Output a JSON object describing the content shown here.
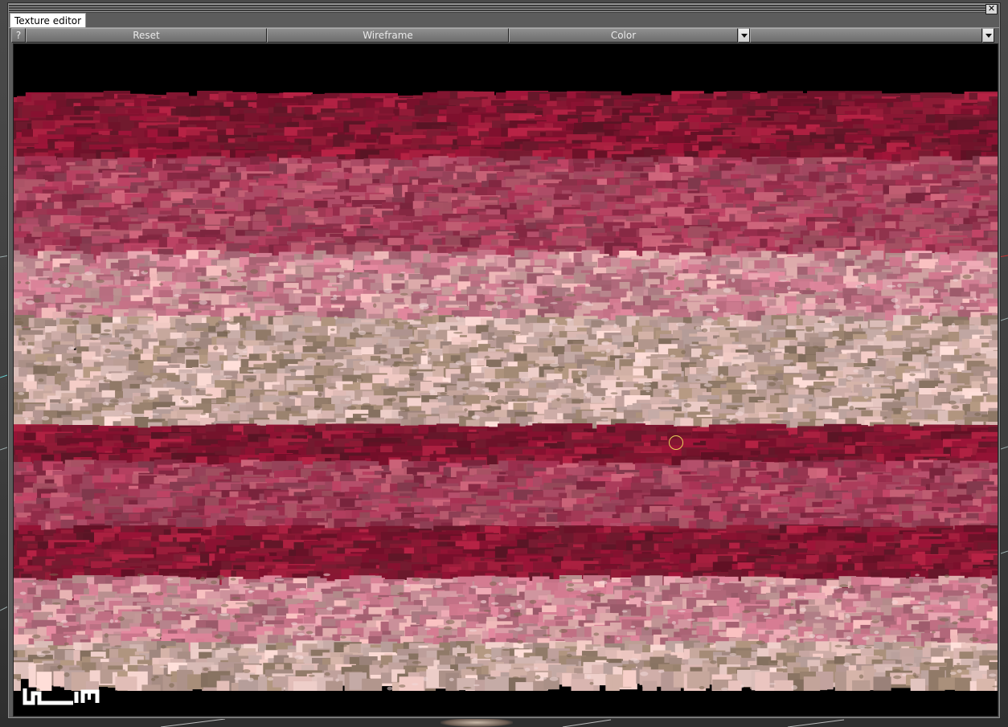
{
  "window": {
    "tab_label": "Texture editor",
    "close_glyph": "✕"
  },
  "toolbar": {
    "help_label": "?",
    "reset_label": "Reset",
    "wireframe_label": "Wireframe",
    "mode_select_value": "Color",
    "second_select_value": ""
  },
  "icons": {
    "close": "close-icon",
    "dropdown": "chevron-down-icon",
    "logo": "app-logo"
  },
  "colors": {
    "deep_crimson": "#8a1230",
    "crimson": "#a0183c",
    "rose": "#b04a62",
    "pink": "#c8788c",
    "pale": "#d8b0b0",
    "tan": "#9a8470",
    "cursor": "#e8d25a"
  }
}
